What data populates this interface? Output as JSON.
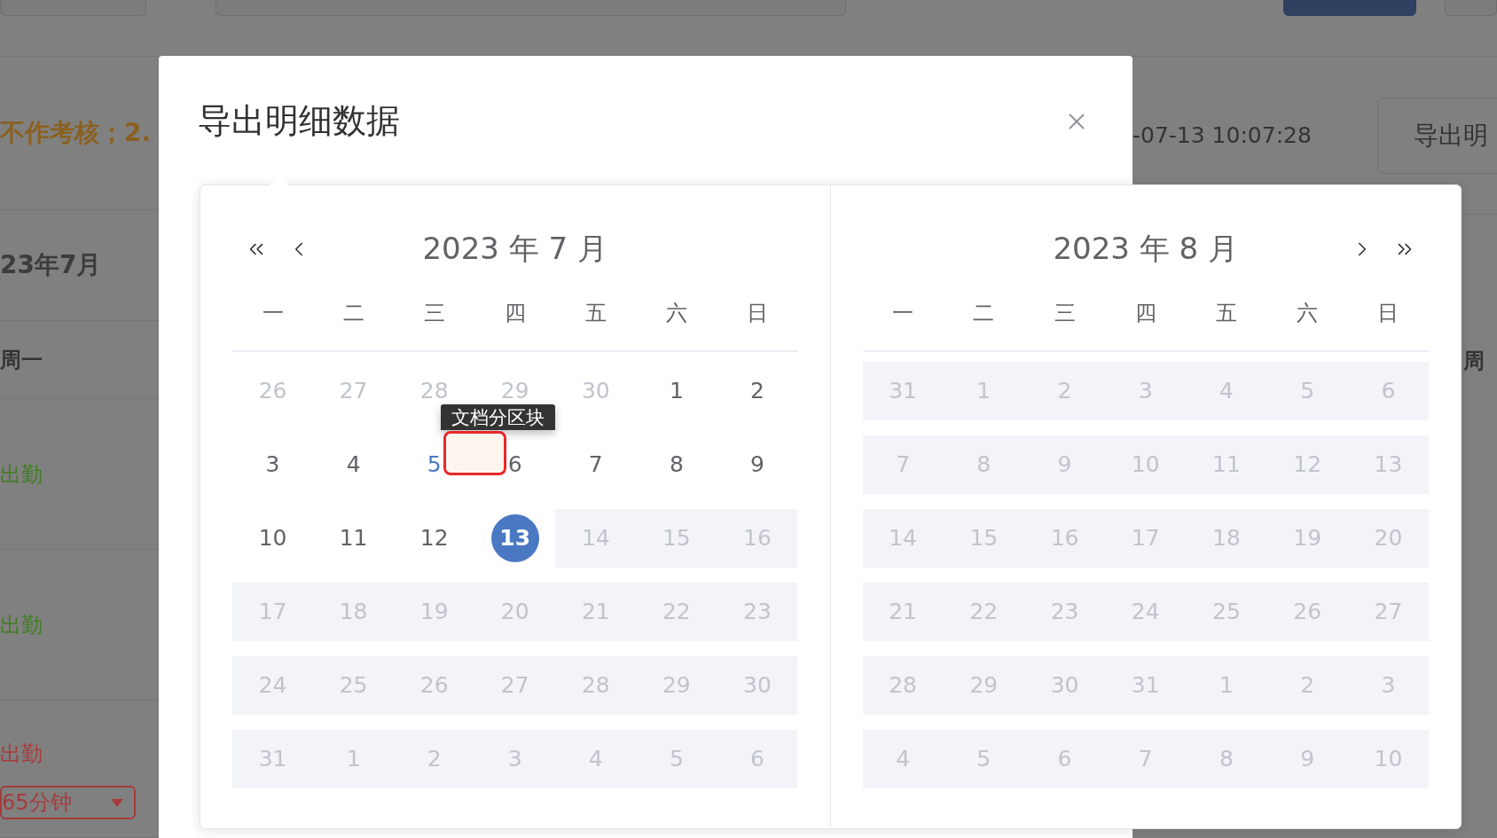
{
  "background": {
    "notice": "不作考核；2.",
    "month_label": "23年7月",
    "weekday_left": "周一",
    "statuses": [
      {
        "label": "出勤",
        "color": "#3f7d20"
      },
      {
        "label": "出勤",
        "color": "#3f7d20"
      },
      {
        "label": "出勤",
        "color": "#a63b3b"
      }
    ],
    "select": {
      "value": "65分钟"
    },
    "timestamp": "-07-13 10:07:28",
    "export_button": "导出明",
    "weekday_right": "周"
  },
  "dialog": {
    "title": "导出明细数据"
  },
  "picker": {
    "months": [
      {
        "title": "2023 年 7 月",
        "weekdays": [
          "一",
          "二",
          "三",
          "四",
          "五",
          "六",
          "日"
        ],
        "weeks": [
          [
            {
              "label": "26",
              "kind": "outside"
            },
            {
              "label": "27",
              "kind": "outside"
            },
            {
              "label": "28",
              "kind": "outside"
            },
            {
              "label": "29",
              "kind": "outside"
            },
            {
              "label": "30",
              "kind": "outside"
            },
            {
              "label": "1",
              "kind": "normal"
            },
            {
              "label": "2",
              "kind": "normal"
            }
          ],
          [
            {
              "label": "3",
              "kind": "normal"
            },
            {
              "label": "4",
              "kind": "normal"
            },
            {
              "label": "5",
              "kind": "hover"
            },
            {
              "label": "6",
              "kind": "normal"
            },
            {
              "label": "7",
              "kind": "normal"
            },
            {
              "label": "8",
              "kind": "normal"
            },
            {
              "label": "9",
              "kind": "normal"
            }
          ],
          [
            {
              "label": "10",
              "kind": "normal"
            },
            {
              "label": "11",
              "kind": "normal"
            },
            {
              "label": "12",
              "kind": "normal"
            },
            {
              "label": "13",
              "kind": "selected"
            },
            {
              "label": "14",
              "kind": "disabled"
            },
            {
              "label": "15",
              "kind": "disabled"
            },
            {
              "label": "16",
              "kind": "disabled"
            }
          ],
          [
            {
              "label": "17",
              "kind": "disabled"
            },
            {
              "label": "18",
              "kind": "disabled"
            },
            {
              "label": "19",
              "kind": "disabled"
            },
            {
              "label": "20",
              "kind": "disabled"
            },
            {
              "label": "21",
              "kind": "disabled"
            },
            {
              "label": "22",
              "kind": "disabled"
            },
            {
              "label": "23",
              "kind": "disabled"
            }
          ],
          [
            {
              "label": "24",
              "kind": "disabled"
            },
            {
              "label": "25",
              "kind": "disabled"
            },
            {
              "label": "26",
              "kind": "disabled"
            },
            {
              "label": "27",
              "kind": "disabled"
            },
            {
              "label": "28",
              "kind": "disabled"
            },
            {
              "label": "29",
              "kind": "disabled"
            },
            {
              "label": "30",
              "kind": "disabled"
            }
          ],
          [
            {
              "label": "31",
              "kind": "disabled"
            },
            {
              "label": "1",
              "kind": "disabled"
            },
            {
              "label": "2",
              "kind": "disabled"
            },
            {
              "label": "3",
              "kind": "disabled"
            },
            {
              "label": "4",
              "kind": "disabled"
            },
            {
              "label": "5",
              "kind": "disabled"
            },
            {
              "label": "6",
              "kind": "disabled"
            }
          ]
        ]
      },
      {
        "title": "2023 年 8 月",
        "weekdays": [
          "一",
          "二",
          "三",
          "四",
          "五",
          "六",
          "日"
        ],
        "weeks": [
          [
            {
              "label": "31",
              "kind": "disabled"
            },
            {
              "label": "1",
              "kind": "disabled"
            },
            {
              "label": "2",
              "kind": "disabled"
            },
            {
              "label": "3",
              "kind": "disabled"
            },
            {
              "label": "4",
              "kind": "disabled"
            },
            {
              "label": "5",
              "kind": "disabled"
            },
            {
              "label": "6",
              "kind": "disabled"
            }
          ],
          [
            {
              "label": "7",
              "kind": "disabled"
            },
            {
              "label": "8",
              "kind": "disabled"
            },
            {
              "label": "9",
              "kind": "disabled"
            },
            {
              "label": "10",
              "kind": "disabled"
            },
            {
              "label": "11",
              "kind": "disabled"
            },
            {
              "label": "12",
              "kind": "disabled"
            },
            {
              "label": "13",
              "kind": "disabled"
            }
          ],
          [
            {
              "label": "14",
              "kind": "disabled"
            },
            {
              "label": "15",
              "kind": "disabled"
            },
            {
              "label": "16",
              "kind": "disabled"
            },
            {
              "label": "17",
              "kind": "disabled"
            },
            {
              "label": "18",
              "kind": "disabled"
            },
            {
              "label": "19",
              "kind": "disabled"
            },
            {
              "label": "20",
              "kind": "disabled"
            }
          ],
          [
            {
              "label": "21",
              "kind": "disabled"
            },
            {
              "label": "22",
              "kind": "disabled"
            },
            {
              "label": "23",
              "kind": "disabled"
            },
            {
              "label": "24",
              "kind": "disabled"
            },
            {
              "label": "25",
              "kind": "disabled"
            },
            {
              "label": "26",
              "kind": "disabled"
            },
            {
              "label": "27",
              "kind": "disabled"
            }
          ],
          [
            {
              "label": "28",
              "kind": "disabled"
            },
            {
              "label": "29",
              "kind": "disabled"
            },
            {
              "label": "30",
              "kind": "disabled"
            },
            {
              "label": "31",
              "kind": "disabled"
            },
            {
              "label": "1",
              "kind": "disabled"
            },
            {
              "label": "2",
              "kind": "disabled"
            },
            {
              "label": "3",
              "kind": "disabled"
            }
          ],
          [
            {
              "label": "4",
              "kind": "disabled"
            },
            {
              "label": "5",
              "kind": "disabled"
            },
            {
              "label": "6",
              "kind": "disabled"
            },
            {
              "label": "7",
              "kind": "disabled"
            },
            {
              "label": "8",
              "kind": "disabled"
            },
            {
              "label": "9",
              "kind": "disabled"
            },
            {
              "label": "10",
              "kind": "disabled"
            }
          ]
        ]
      }
    ]
  },
  "annotation": {
    "label": "文档分区块"
  }
}
